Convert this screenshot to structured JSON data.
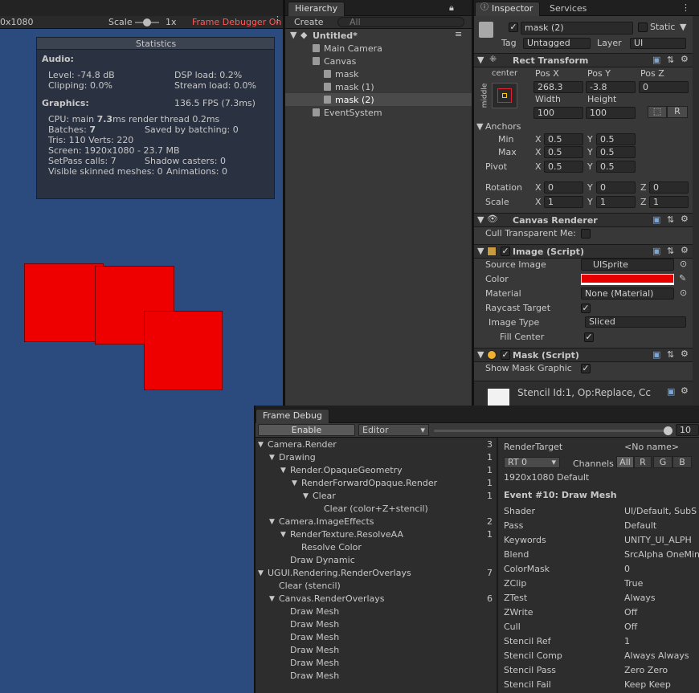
{
  "game": {
    "resolution": "0x1080",
    "scale_label": "Scale",
    "scale_value": "1x",
    "frame_debugger_on": "Frame Debugger On"
  },
  "stats": {
    "title": "Statistics",
    "audio_header": "Audio:",
    "level": "Level: -74.8 dB",
    "clipping": "Clipping: 0.0%",
    "dsp": "DSP load: 0.2%",
    "stream": "Stream load: 0.0%",
    "graphics_header": "Graphics:",
    "fps": "136.5 FPS (7.3ms)",
    "cpu_prefix": "CPU: main ",
    "cpu_main": "7.3",
    "cpu_suffix": "ms  render thread 0.2ms",
    "batches_prefix": "Batches: ",
    "batches": "7",
    "saved": "Saved by batching: 0",
    "tris": "Tris: 110 Verts: 220",
    "screen": "Screen: 1920x1080 - 23.7 MB",
    "setpass": "SetPass calls: 7",
    "shadow": "Shadow casters: 0",
    "skinned": "Visible skinned meshes: 0",
    "animations": "Animations: 0"
  },
  "hierarchy": {
    "tab": "Hierarchy",
    "create": "Create",
    "search_placeholder": "All",
    "scene": "Untitled*",
    "items": [
      "Main Camera",
      "Canvas",
      "mask",
      "mask (1)",
      "mask (2)",
      "EventSystem"
    ]
  },
  "inspector": {
    "tab": "Inspector",
    "tab2": "Services",
    "name": "mask (2)",
    "static_label": "Static",
    "tag_label": "Tag",
    "tag_value": "Untagged",
    "layer_label": "Layer",
    "layer_value": "UI",
    "rect": {
      "title": "Rect Transform",
      "anchor_h": "center",
      "anchor_v": "middle",
      "posx_label": "Pos X",
      "posy_label": "Pos Y",
      "posz_label": "Pos Z",
      "posx": "268.3",
      "posy": "-3.8",
      "posz": "0",
      "width_label": "Width",
      "height_label": "Height",
      "width": "100",
      "height": "100",
      "r_btn": "R",
      "anchors": "Anchors",
      "min": "Min",
      "max": "Max",
      "pivot": "Pivot",
      "x": "X",
      "y": "Y",
      "z": "Z",
      "min_x": "0.5",
      "min_y": "0.5",
      "max_x": "0.5",
      "max_y": "0.5",
      "pivot_x": "0.5",
      "pivot_y": "0.5",
      "rotation": "Rotation",
      "rot_x": "0",
      "rot_y": "0",
      "rot_z": "0",
      "scale": "Scale",
      "sc_x": "1",
      "sc_y": "1",
      "sc_z": "1"
    },
    "canvas_renderer": {
      "title": "Canvas Renderer",
      "cull": "Cull Transparent Me:"
    },
    "image": {
      "title": "Image (Script)",
      "source_label": "Source Image",
      "source_value": "UISprite",
      "color_label": "Color",
      "color": "#e60000",
      "material_label": "Material",
      "material_value": "None (Material)",
      "raycast_label": "Raycast Target",
      "type_label": "Image Type",
      "type_value": "Sliced",
      "fill_label": "Fill Center"
    },
    "mask": {
      "title": "Mask (Script)",
      "show_label": "Show Mask Graphic"
    },
    "stencil": "Stencil Id:1, Op:Replace, Cc"
  },
  "frame_debug": {
    "tab": "Frame Debug",
    "enable": "Enable",
    "editor": "Editor",
    "slider_value": "10",
    "tree": [
      {
        "label": "Camera.Render",
        "count": "1"
      },
      {
        "label": "Drawing",
        "count": "1"
      },
      {
        "label": "Render.OpaqueGeometry",
        "count": "1"
      },
      {
        "label": "RenderForwardOpaque.Render",
        "count": "1"
      },
      {
        "label": "Clear",
        "count": "1"
      },
      {
        "label": "Clear (color+Z+stencil)",
        "count": ""
      },
      {
        "label": "Camera.ImageEffects",
        "count": "2"
      },
      {
        "label": "RenderTexture.ResolveAA",
        "count": "1"
      },
      {
        "label": "Resolve Color",
        "count": ""
      },
      {
        "label": "Draw Dynamic",
        "count": ""
      },
      {
        "label": "UGUI.Rendering.RenderOverlays",
        "count": "7"
      },
      {
        "label": "Clear (stencil)",
        "count": ""
      },
      {
        "label": "Canvas.RenderOverlays",
        "count": "6"
      },
      {
        "label": "Draw Mesh",
        "count": ""
      },
      {
        "label": "Draw Mesh",
        "count": ""
      },
      {
        "label": "Draw Mesh",
        "count": ""
      },
      {
        "label": "Draw Mesh",
        "count": ""
      },
      {
        "label": "Draw Mesh",
        "count": ""
      },
      {
        "label": "Draw Mesh",
        "count": ""
      }
    ],
    "first_count": "3",
    "rt_label": "RenderTarget",
    "rt_value": "<No name>",
    "rt0": "RT 0",
    "channels": "Channels",
    "ch_all": "All",
    "ch_r": "R",
    "ch_g": "G",
    "ch_b": "B",
    "default": "1920x1080 Default",
    "event": "Event #10: Draw Mesh",
    "props": [
      [
        "Shader",
        "UI/Default, SubS"
      ],
      [
        "Pass",
        "Default"
      ],
      [
        "Keywords",
        "UNITY_UI_ALPH"
      ],
      [
        "Blend",
        "SrcAlpha OneMin"
      ],
      [
        "ColorMask",
        "0"
      ],
      [
        "ZClip",
        "True"
      ],
      [
        "ZTest",
        "Always"
      ],
      [
        "ZWrite",
        "Off"
      ],
      [
        "Cull",
        "Off"
      ],
      [
        "Stencil Ref",
        "1"
      ],
      [
        "Stencil Comp",
        "Always Always"
      ],
      [
        "Stencil Pass",
        "Zero Zero"
      ],
      [
        "Stencil Fail",
        "Keep Keep"
      ]
    ]
  }
}
